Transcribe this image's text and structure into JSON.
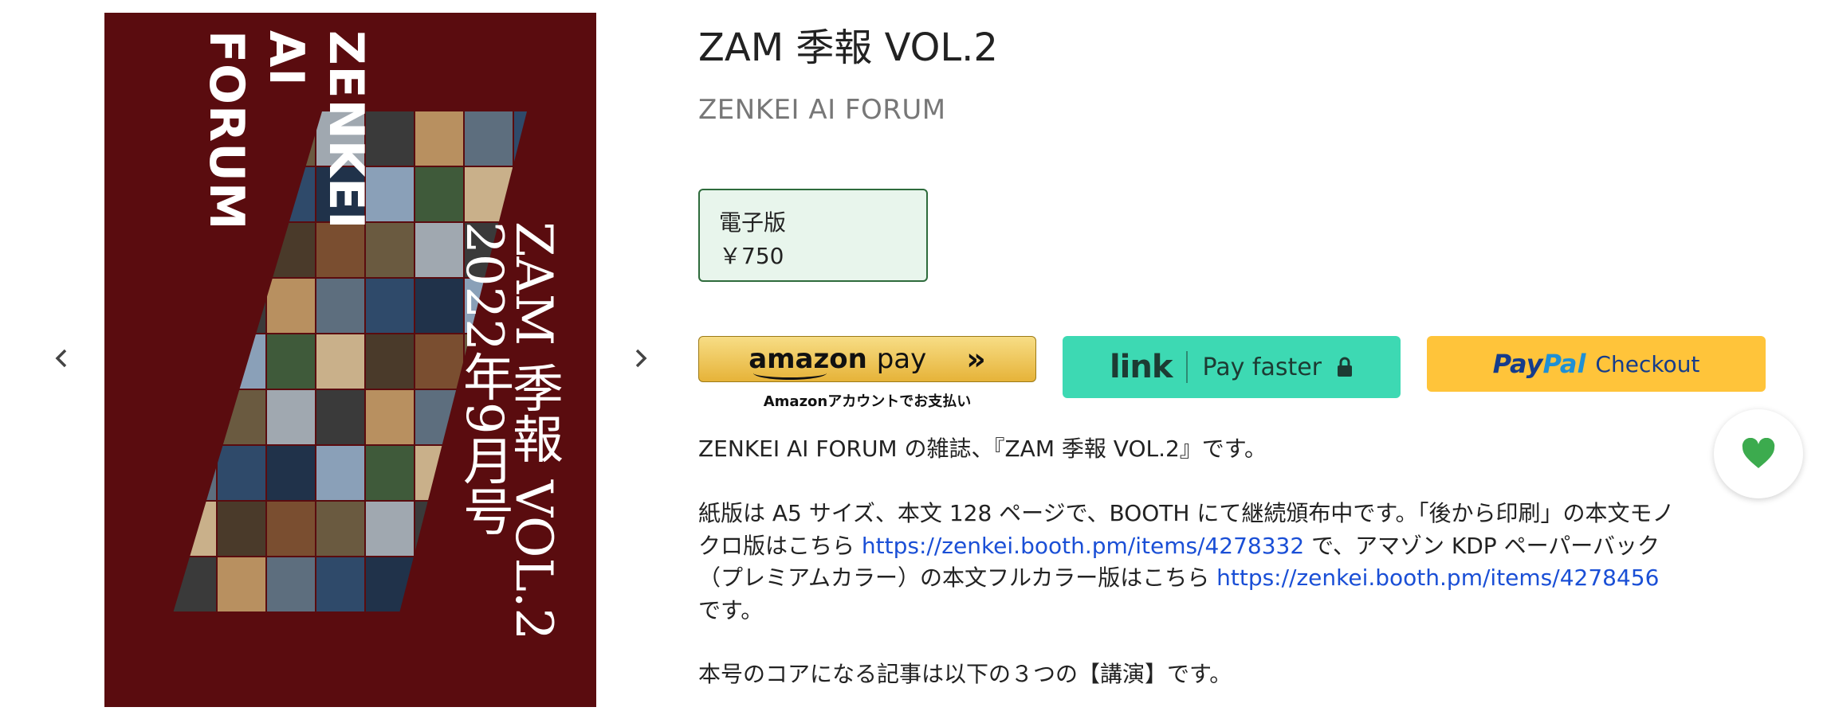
{
  "product": {
    "title": "ZAM 季報 VOL.2",
    "author": "ZENKEI AI FORUM"
  },
  "cover": {
    "brand_text": "ZENKEI\nAI\nFORUM",
    "title_text": "ZAM 季報 VOL.2\n2022年9月号",
    "background_color": "#5a0c0f"
  },
  "variant": {
    "name": "電子版",
    "price": "￥750"
  },
  "payments": {
    "amazon": {
      "logo": "amazon",
      "pay": "pay",
      "chevrons": "»",
      "sub": "Amazonアカウントでお支払い"
    },
    "link": {
      "logo": "link",
      "label": "Pay faster"
    },
    "paypal": {
      "logo_a": "Pay",
      "logo_b": "Pal",
      "label": "Checkout"
    }
  },
  "description": {
    "p1": "ZENKEI AI FORUM の雑誌、『ZAM 季報 VOL.2』です。",
    "p2_a": "紙版は A5 サイズ、本文 128 ページで、BOOTH にて継続頒布中です。「後から印刷」の本文モノクロ版はこちら ",
    "p2_link1": "https://zenkei.booth.pm/items/4278332",
    "p2_b": " で、アマゾン KDP ペーパーバック（プレミアムカラー）の本文フルカラー版はこちら ",
    "p2_link2": "https://zenkei.booth.pm/items/4278456",
    "p2_c": " です。",
    "p3": "本号のコアになる記事は以下の３つの【講演】です。"
  },
  "icons": {
    "prev": "chevron-left-icon",
    "next": "chevron-right-icon",
    "favorite": "heart-icon",
    "lock": "lock-icon"
  },
  "colors": {
    "accent_green": "#2e6b3c",
    "variant_bg": "#e8f5ec",
    "link_blue": "#1a4fd6",
    "heart": "#3cab4e"
  }
}
